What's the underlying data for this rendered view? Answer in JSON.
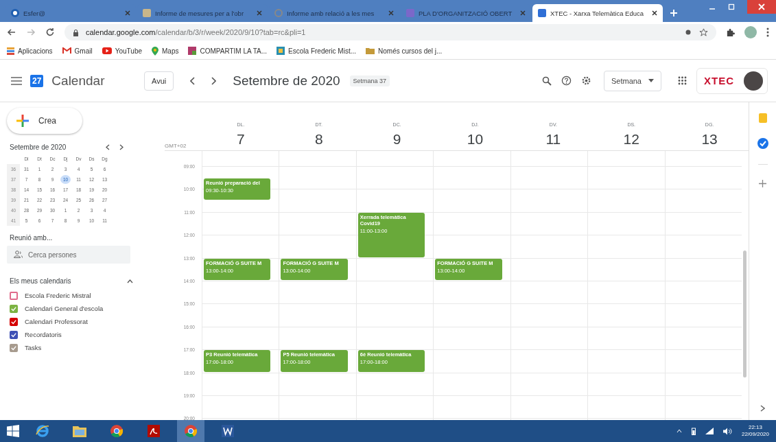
{
  "browser": {
    "tabs": [
      {
        "title": "Esfer@",
        "kind": "esfera",
        "selected": false
      },
      {
        "title": "Informe de mesures per a l'obr",
        "kind": "doc",
        "selected": false
      },
      {
        "title": "Informe amb relació a les mes",
        "kind": "globe",
        "selected": false
      },
      {
        "title": "PLA D'ORGANITZACIÓ OBERT",
        "kind": "form",
        "selected": false
      },
      {
        "title": "XTEC - Xarxa Telemàtica Educa",
        "kind": "calendar",
        "selected": true
      }
    ],
    "url_host": "calendar.google.com",
    "url_path": "/calendar/b/3/r/week/2020/9/10?tab=rc&pli=1",
    "bookmarks": [
      {
        "label": "Aplicacions",
        "kind": "apps"
      },
      {
        "label": "Gmail",
        "kind": "gmail"
      },
      {
        "label": "YouTube",
        "kind": "youtube"
      },
      {
        "label": "Maps",
        "kind": "maps"
      },
      {
        "label": "COMPARTIM LA TA...",
        "kind": "tile"
      },
      {
        "label": "Escola Frederic Mist...",
        "kind": "site"
      },
      {
        "label": "Només cursos del j...",
        "kind": "folder"
      }
    ]
  },
  "header": {
    "logo_day": "27",
    "app_name": "Calendar",
    "today_button": "Avui",
    "period": "Setembre de 2020",
    "week_badge": "Setmana 37",
    "view_select": "Setmana",
    "org_logo": "XTEC"
  },
  "sidebar": {
    "create_button": "Crea",
    "mini_calendar": {
      "title": "Setembre de 2020",
      "weekdays": [
        "Dl",
        "Dt",
        "Dc",
        "Dj",
        "Dv",
        "Ds",
        "Dg"
      ],
      "weeks": [
        {
          "number": "36",
          "days": [
            {
              "label": "31",
              "selected": false
            },
            {
              "label": "1",
              "selected": false
            },
            {
              "label": "2",
              "selected": false
            },
            {
              "label": "3",
              "selected": false
            },
            {
              "label": "4",
              "selected": false
            },
            {
              "label": "5",
              "selected": false
            },
            {
              "label": "6",
              "selected": false
            }
          ]
        },
        {
          "number": "37",
          "days": [
            {
              "label": "7",
              "selected": false
            },
            {
              "label": "8",
              "selected": false
            },
            {
              "label": "9",
              "selected": false
            },
            {
              "label": "10",
              "selected": true
            },
            {
              "label": "11",
              "selected": false
            },
            {
              "label": "12",
              "selected": false
            },
            {
              "label": "13",
              "selected": false
            }
          ]
        },
        {
          "number": "38",
          "days": [
            {
              "label": "14",
              "selected": false
            },
            {
              "label": "15",
              "selected": false
            },
            {
              "label": "16",
              "selected": false
            },
            {
              "label": "17",
              "selected": false
            },
            {
              "label": "18",
              "selected": false
            },
            {
              "label": "19",
              "selected": false
            },
            {
              "label": "20",
              "selected": false
            }
          ]
        },
        {
          "number": "39",
          "days": [
            {
              "label": "21",
              "selected": false
            },
            {
              "label": "22",
              "selected": false
            },
            {
              "label": "23",
              "selected": false
            },
            {
              "label": "24",
              "selected": false
            },
            {
              "label": "25",
              "selected": false
            },
            {
              "label": "26",
              "selected": false
            },
            {
              "label": "27",
              "selected": false
            }
          ]
        },
        {
          "number": "40",
          "days": [
            {
              "label": "28",
              "selected": false
            },
            {
              "label": "29",
              "selected": false
            },
            {
              "label": "30",
              "selected": false
            },
            {
              "label": "1",
              "selected": false
            },
            {
              "label": "2",
              "selected": false
            },
            {
              "label": "3",
              "selected": false
            },
            {
              "label": "4",
              "selected": false
            }
          ]
        },
        {
          "number": "41",
          "days": [
            {
              "label": "5",
              "selected": false
            },
            {
              "label": "6",
              "selected": false
            },
            {
              "label": "7",
              "selected": false
            },
            {
              "label": "8",
              "selected": false
            },
            {
              "label": "9",
              "selected": false
            },
            {
              "label": "10",
              "selected": false
            },
            {
              "label": "11",
              "selected": false
            }
          ]
        }
      ]
    },
    "meet_title": "Reunió amb...",
    "people_search": {
      "placeholder": "Cerca persones"
    },
    "calendars_title": "Els meus calendaris",
    "calendars": [
      {
        "label": "Escola Frederic Mistral",
        "checked": false,
        "color": "#e06b8b"
      },
      {
        "label": "Calendari General d'escola",
        "checked": true,
        "color": "#7cb342"
      },
      {
        "label": "Calendari Professorat",
        "checked": true,
        "color": "#d50000"
      },
      {
        "label": "Recordatoris",
        "checked": true,
        "color": "#3f51b5"
      },
      {
        "label": "Tasks",
        "checked": true,
        "color": "#a79b8e"
      }
    ]
  },
  "week": {
    "timezone": "GMT+02",
    "hours": [
      "09:00",
      "10:00",
      "11:00",
      "12:00",
      "13:00",
      "14:00",
      "15:00",
      "16:00",
      "17:00",
      "18:00",
      "19:00",
      "20:00"
    ],
    "days": [
      {
        "weekday": "DL.",
        "date": "7",
        "events": [
          {
            "title": "Reunió preparació del",
            "time": "09:30-10:30"
          },
          {
            "title": "FORMACIÓ G SUITE M",
            "time": "13:00-14:00"
          },
          {
            "title": "P3 Reunió telemàtica",
            "time": "17:00-18:00"
          }
        ]
      },
      {
        "weekday": "DT.",
        "date": "8",
        "events": [
          {
            "title": "FORMACIÓ G SUITE M",
            "time": "13:00-14:00"
          },
          {
            "title": "P5 Reunió telemàtica",
            "time": "17:00-18:00"
          }
        ]
      },
      {
        "weekday": "DC.",
        "date": "9",
        "events": [
          {
            "title": "Xerrada telemàtica Covid19",
            "time": "11:00-13:00"
          },
          {
            "title": "6è Reunió telemàtica",
            "time": "17:00-18:00"
          }
        ]
      },
      {
        "weekday": "DJ.",
        "date": "10",
        "events": [
          {
            "title": "FORMACIÓ G SUITE M",
            "time": "13:00-14:00"
          }
        ]
      },
      {
        "weekday": "DV.",
        "date": "11"
      },
      {
        "weekday": "DS.",
        "date": "12"
      },
      {
        "weekday": "DG.",
        "date": "13"
      }
    ]
  },
  "taskbar": {
    "apps": [
      {
        "kind": "ie",
        "selected": false
      },
      {
        "kind": "explorer",
        "selected": false
      },
      {
        "kind": "chrome",
        "selected": false
      },
      {
        "kind": "acrobat",
        "selected": false
      },
      {
        "kind": "chrome",
        "selected": true
      },
      {
        "kind": "word",
        "selected": false
      }
    ],
    "time": "22:13",
    "date": "22/09/2020"
  }
}
